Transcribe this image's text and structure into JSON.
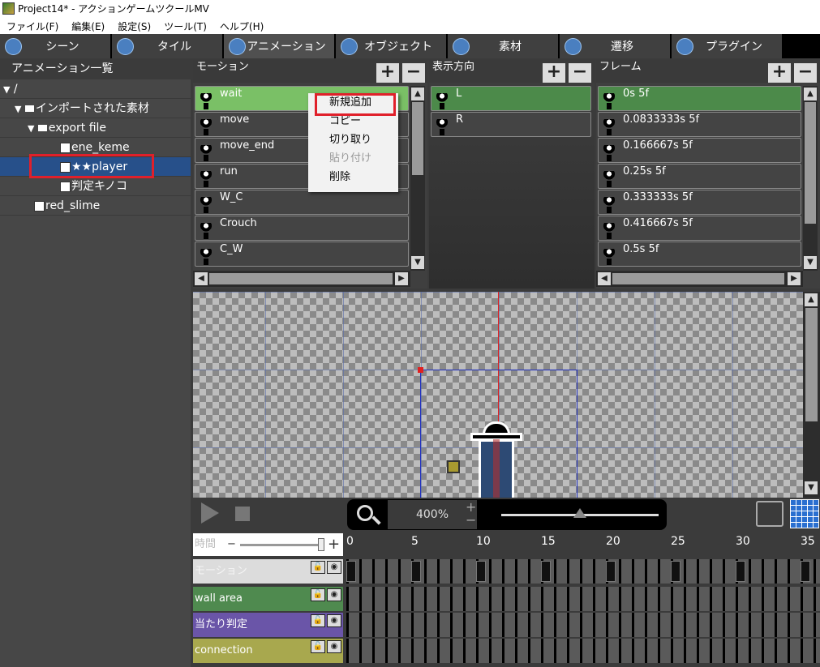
{
  "window": {
    "title": "Project14* - アクションゲームツクールMV"
  },
  "menu": [
    "ファイル(F)",
    "編集(E)",
    "設定(S)",
    "ツール(T)",
    "ヘルプ(H)"
  ],
  "tabs": [
    {
      "label": "シーン",
      "icon": "scene-icon"
    },
    {
      "label": "タイル",
      "icon": "tile-icon"
    },
    {
      "label": "アニメーション",
      "icon": "animation-icon"
    },
    {
      "label": "オブジェクト",
      "icon": "object-icon"
    },
    {
      "label": "素材",
      "icon": "material-icon"
    },
    {
      "label": "遷移",
      "icon": "transition-icon"
    },
    {
      "label": "プラグイン",
      "icon": "plugin-icon"
    }
  ],
  "left": {
    "header": "アニメーション一覧",
    "root": "/",
    "imported": "インポートされた素材",
    "export_file": "export file",
    "items": [
      "ene_keme",
      "★★player",
      "判定キノコ",
      "red_slime"
    ]
  },
  "motion": {
    "header": "モーション",
    "items": [
      "wait",
      "move",
      "move_end",
      "run",
      "W_C",
      "Crouch",
      "C_W"
    ]
  },
  "direction": {
    "header": "表示方向",
    "items": [
      "L",
      "R"
    ]
  },
  "frame": {
    "header": "フレーム",
    "items": [
      "0s 5f",
      "0.0833333s 5f",
      "0.166667s 5f",
      "0.25s 5f",
      "0.333333s 5f",
      "0.416667s 5f",
      "0.5s 5f"
    ]
  },
  "context_menu": {
    "items": [
      "新規追加",
      "コピー",
      "切り取り",
      "貼り付け",
      "削除"
    ]
  },
  "toolbar": {
    "zoom": "400%",
    "zoom_slider_level": 0.5
  },
  "timeline": {
    "time_label": "時間",
    "ticks": [
      "0",
      "5",
      "10",
      "15",
      "20",
      "25",
      "30",
      "35"
    ],
    "tracks": [
      "モーション",
      "wall area",
      "当たり判定",
      "connection"
    ],
    "track_colors": [
      "#dcdcdc",
      "#4f8a4f",
      "#6a55a8",
      "#a8a84e"
    ]
  }
}
